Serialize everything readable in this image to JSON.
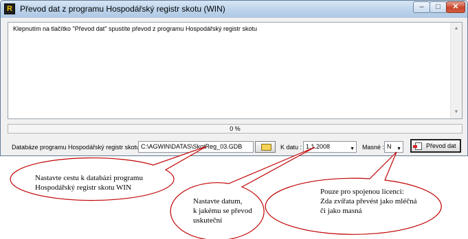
{
  "window": {
    "title": "Převod dat z programu Hospodářský registr skotu (WIN)",
    "minimize_glyph": "–",
    "maximize_glyph": "□",
    "close_glyph": "✕"
  },
  "message": "Klepnutím na tlačítko \"Převod dat\" spustíte převod z programu Hospodářský registr skotu",
  "progress": {
    "value": 0,
    "label": "0 %"
  },
  "database": {
    "label": "Databáze programu Hospodářský registr skotu :",
    "path": "C:\\AGWIN\\DATAS\\SkotReg_03.GDB",
    "browse_icon": "folder-open-icon"
  },
  "date": {
    "label": "K datu :",
    "value": "1.1.2008"
  },
  "masne": {
    "label": "Masné :",
    "value": "N"
  },
  "convert_button": {
    "label": "Převod dat",
    "icon": "convert-icon"
  },
  "callouts": {
    "path_lines": [
      "Nastavte cestu k databázi programu",
      "Hospodářský registr skotu WIN"
    ],
    "date_lines": [
      "Nastavte datum,",
      "k jakému se převod",
      "uskuteční"
    ],
    "license_lines": [
      "Pouze pro spojenou licenci:",
      "Zda zvířata převést jako mléčná",
      "či jako masná"
    ]
  },
  "colors": {
    "progress_fill": "#3c9b3c",
    "title_bar": "#c4d9ef"
  }
}
